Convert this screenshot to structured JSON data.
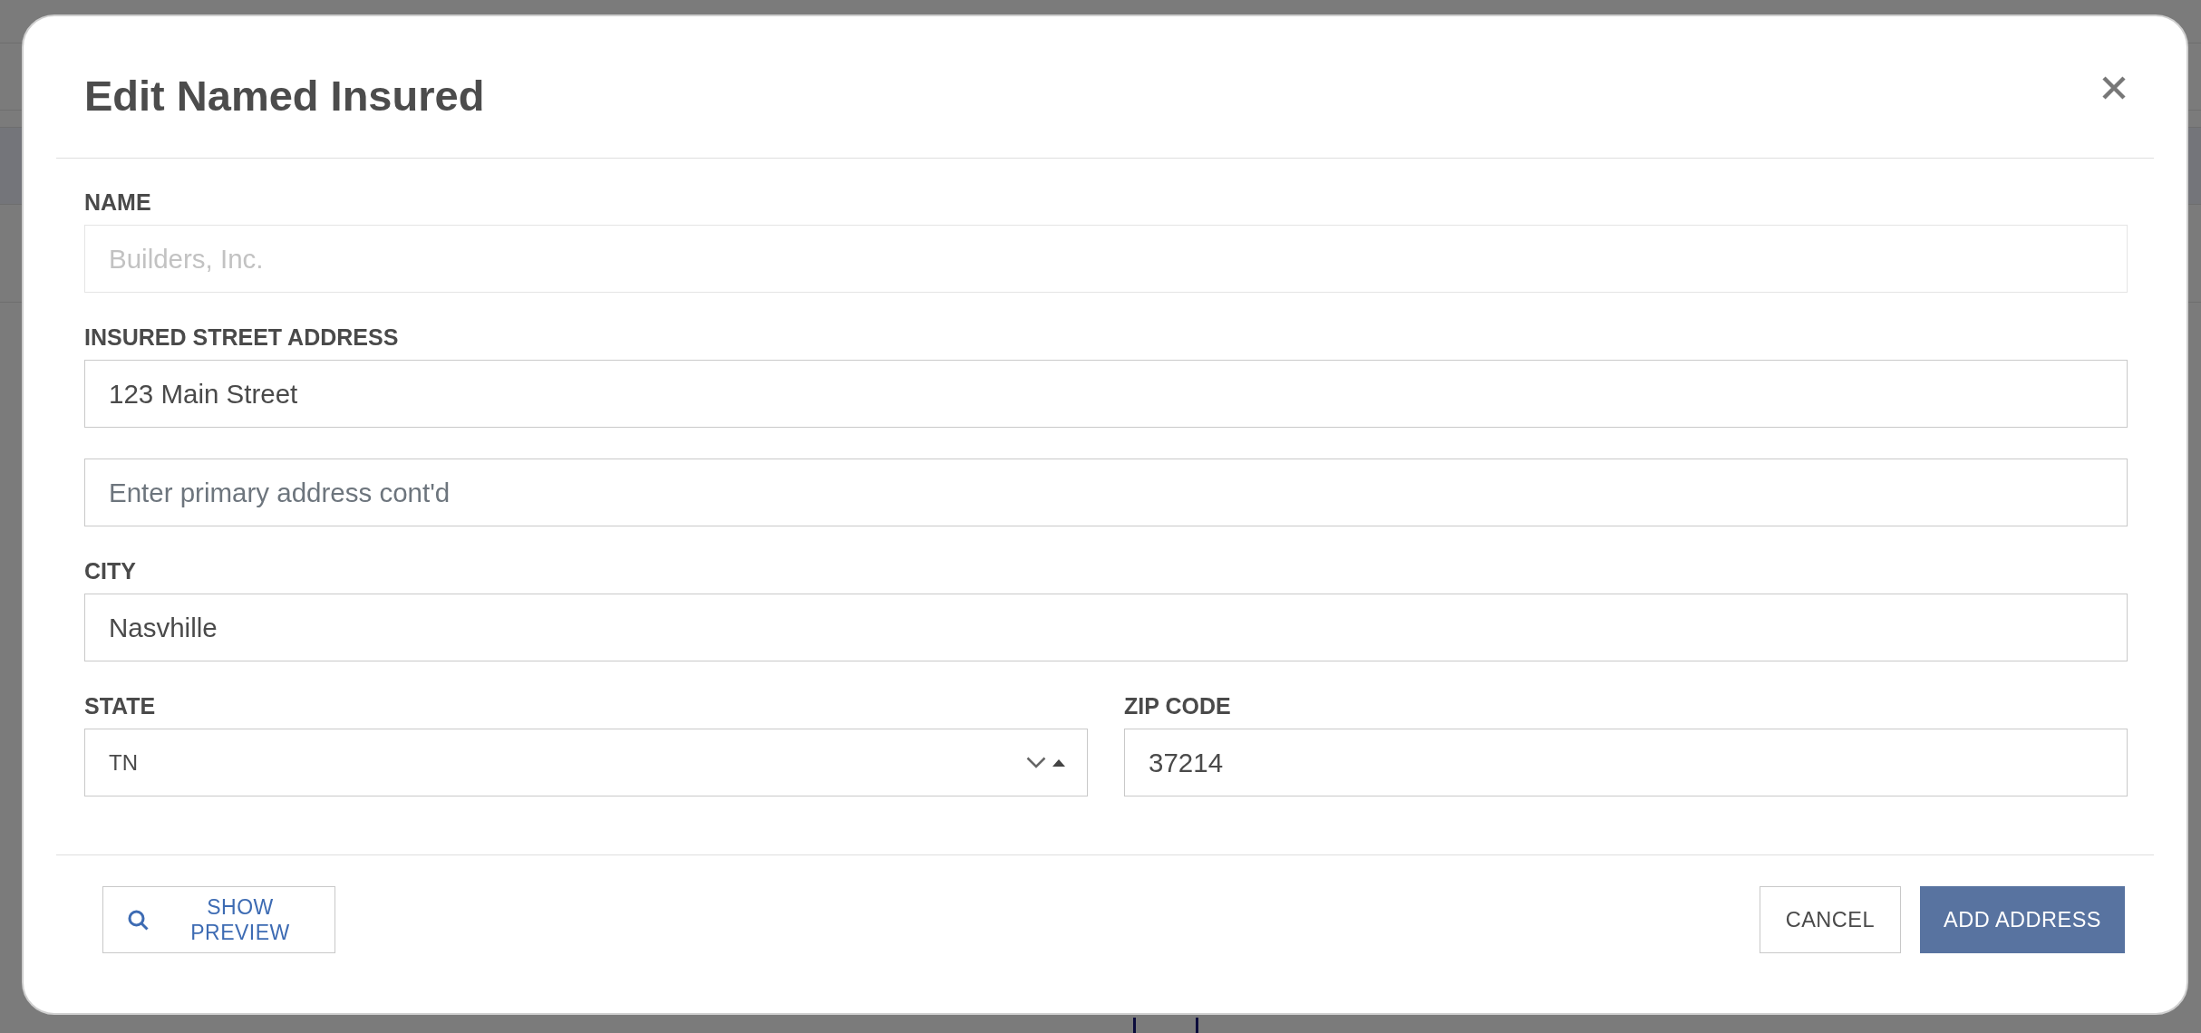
{
  "dialog": {
    "title": "Edit Named Insured"
  },
  "form": {
    "rows": [
      {
        "fields": [
          {
            "kind": "text",
            "label": "NAME",
            "value": "Builders, Inc.",
            "disabled": true
          }
        ]
      },
      {
        "fields": [
          {
            "kind": "text",
            "label": "INSURED STREET ADDRESS",
            "value": "123 Main Street",
            "disabled": false
          }
        ]
      },
      {
        "fields": [
          {
            "kind": "text",
            "placeholder": "Enter primary address cont'd",
            "disabled": false
          }
        ]
      },
      {
        "fields": [
          {
            "kind": "text",
            "label": "CITY",
            "value": "Nasvhille",
            "disabled": false
          }
        ]
      },
      {
        "fields": [
          {
            "kind": "select",
            "label": "STATE",
            "value": "TN",
            "disabled": false
          },
          {
            "kind": "text",
            "label": "ZIP CODE",
            "value": "37214",
            "disabled": false
          }
        ]
      }
    ]
  },
  "footer": {
    "preview_button": {
      "label": "SHOW PREVIEW"
    },
    "actions": [
      {
        "kind": "secondary",
        "label": "CANCEL"
      },
      {
        "kind": "primary",
        "label": "ADD ADDRESS"
      }
    ]
  }
}
